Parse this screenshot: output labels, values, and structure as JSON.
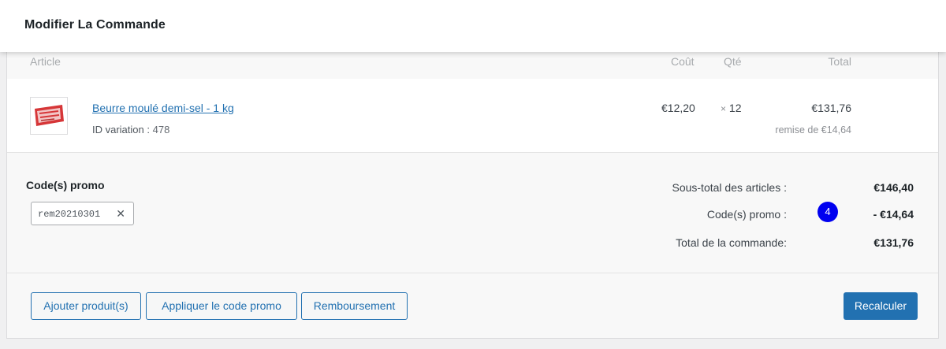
{
  "header": {
    "title": "Modifier La Commande"
  },
  "table": {
    "headers": {
      "article": "Article",
      "cost": "Coût",
      "qty": "Qté",
      "total": "Total"
    },
    "items": [
      {
        "name": "Beurre moulé demi-sel - 1 kg",
        "variation_label": "ID variation :",
        "variation_id": "478",
        "cost": "€12,20",
        "qty_prefix": "×",
        "qty": "12",
        "total": "€131,76",
        "discount": "remise de €14,64"
      }
    ]
  },
  "promo": {
    "title": "Code(s) promo",
    "code": "rem20210301",
    "remove_icon": "close-icon"
  },
  "totals": {
    "subtotal_label": "Sous-total des articles :",
    "subtotal_value": "€146,40",
    "promo_label": "Code(s) promo :",
    "promo_value": "- €14,64",
    "order_total_label": "Total de la commande:",
    "order_total_value": "€131,76"
  },
  "badge": {
    "value": "4"
  },
  "buttons": {
    "add_product": "Ajouter produit(s)",
    "apply_coupon": "Appliquer le code promo",
    "refund": "Remboursement",
    "recalculate": "Recalculer"
  },
  "colors": {
    "accent": "#2271b1",
    "badge": "#0000f0",
    "panel": "#f8f8f8"
  }
}
